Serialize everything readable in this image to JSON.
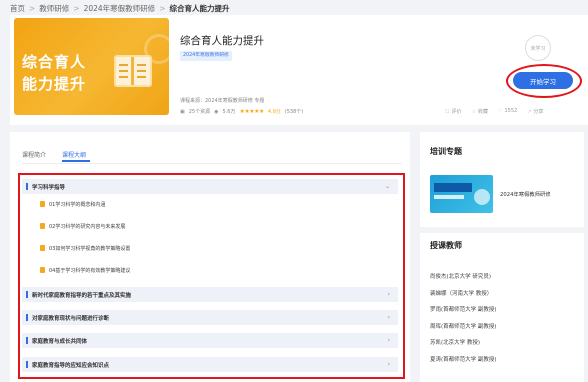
{
  "breadcrumb": {
    "items": [
      "首页",
      "教师研修",
      "2024年寒假教师研修"
    ],
    "current": "综合育人能力提升",
    "separator": ">"
  },
  "course": {
    "cover_text_line1": "综合育人",
    "cover_text_line2": "能力提升",
    "title": "综合育人能力提升",
    "tag": "2024年寒假教师研修",
    "source": "课程来源：2024年寒假教师研修 专题",
    "resources": "25个资源",
    "learners": "5.6万",
    "stars": "★★★★★",
    "score": "4.9分",
    "ratings": "(538个)",
    "status": "未学习",
    "start_button": "开始学习",
    "actions": [
      {
        "icon": "☐",
        "label": "评价"
      },
      {
        "icon": "☆",
        "label": "收藏"
      },
      {
        "icon": "♡",
        "label": "1552"
      },
      {
        "icon": "↗",
        "label": "分享"
      }
    ]
  },
  "tabs": {
    "intro": "课程简介",
    "outline": "课程大纲"
  },
  "outline": {
    "section1": "学习科学指导",
    "subs": [
      "01学习科学的概念和内涵",
      "02学习科学的研究内容与未来发展",
      "03如何学习科学视角的教学策略设置",
      "04基于学习科学的有效教学策略建议"
    ],
    "sections": [
      "新时代家庭教育指导的若干重点及其实施",
      "对家庭教育现状与问题进行诊断",
      "家庭教育与成长共同体",
      "家庭教育指导的应知应会知识点"
    ],
    "chevron_open": "⌄",
    "chevron_closed": "›"
  },
  "sidebar": {
    "training_title": "培训专题",
    "training_item": "2024年寒假教师研修",
    "teachers_title": "授课教师",
    "teachers": [
      "尚俊杰(北京大学 研究员)",
      "裴娣娜（河南大学 教授）",
      "罗雨(首都师范大学 副教授)",
      "周晖(首都师范大学 副教授)",
      "苏凯(北京大学 教授)",
      "夏涛(首都师范大学 副教授)"
    ]
  },
  "colors": {
    "accent": "#2f6fe4",
    "highlight": "#e0161c",
    "star": "#f7a81c"
  }
}
